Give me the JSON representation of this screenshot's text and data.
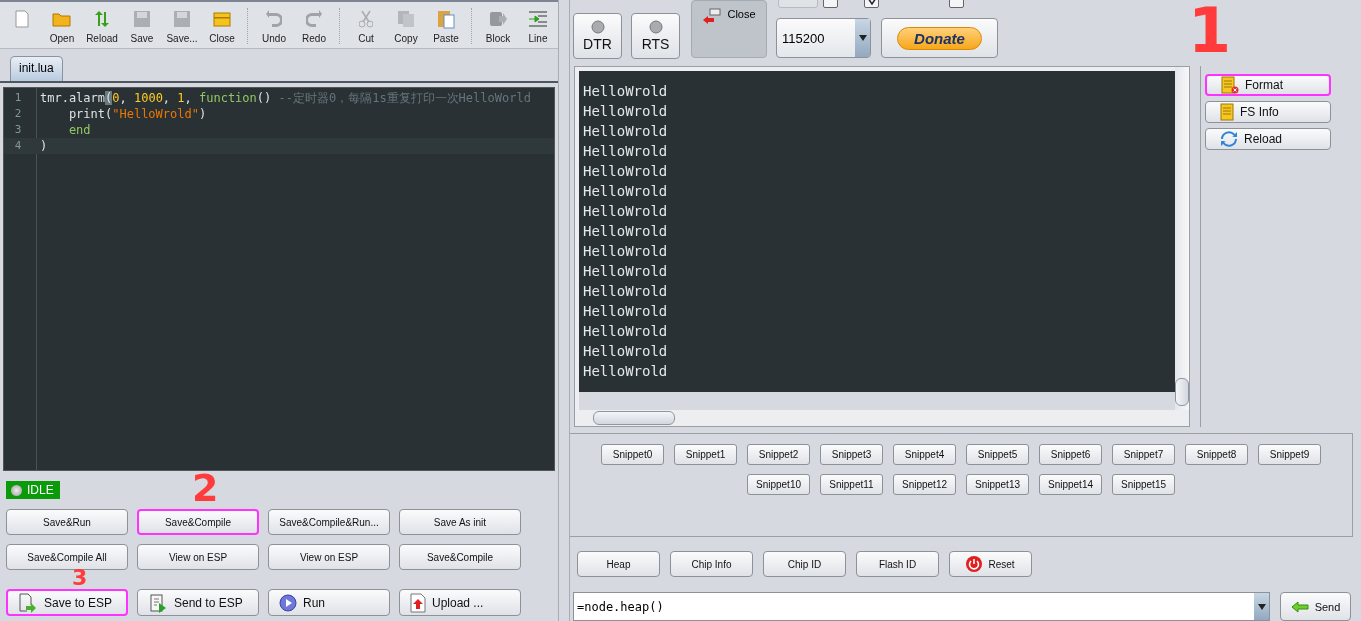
{
  "toolbar": {
    "groups": [
      [
        {
          "kind": "new",
          "disabled": false
        },
        {
          "label": "Open",
          "disabled": false
        },
        {
          "label": "Reload",
          "disabled": false
        },
        {
          "label": "Save",
          "disabled": true
        },
        {
          "label": "Save...",
          "disabled": true
        },
        {
          "label": "Close",
          "disabled": false
        }
      ],
      [
        {
          "label": "Undo",
          "disabled": true
        },
        {
          "label": "Redo",
          "disabled": true
        }
      ],
      [
        {
          "label": "Cut",
          "disabled": true
        },
        {
          "label": "Copy",
          "disabled": true
        },
        {
          "label": "Paste",
          "disabled": false
        }
      ],
      [
        {
          "label": "Block",
          "disabled": true
        },
        {
          "label": "Line",
          "disabled": false
        }
      ]
    ]
  },
  "tabs": [
    {
      "label": "init.lua",
      "selected": true
    }
  ],
  "editor": {
    "lines": [
      {
        "number": "1",
        "current": false,
        "tokens": [
          {
            "kind": "plain",
            "text": "tmr.alarm"
          },
          {
            "kind": "cursor",
            "text": "("
          },
          {
            "kind": "number",
            "text": "0"
          },
          {
            "kind": "plain",
            "text": ", "
          },
          {
            "kind": "number",
            "text": "1000"
          },
          {
            "kind": "plain",
            "text": ", "
          },
          {
            "kind": "number",
            "text": "1"
          },
          {
            "kind": "plain",
            "text": ", "
          },
          {
            "kind": "keyword",
            "text": "function"
          },
          {
            "kind": "plain",
            "text": "() "
          },
          {
            "kind": "comment",
            "text": "--定时器0，每隔1s重复打印一次HelloWorld"
          }
        ]
      },
      {
        "number": "2",
        "current": false,
        "tokens": [
          {
            "kind": "plain",
            "text": "    print("
          },
          {
            "kind": "string",
            "text": "\"HelloWrold\""
          },
          {
            "kind": "plain",
            "text": ")"
          }
        ]
      },
      {
        "number": "3",
        "current": false,
        "tokens": [
          {
            "kind": "keyword",
            "text": "    end"
          }
        ]
      },
      {
        "number": "4",
        "current": true,
        "tokens": [
          {
            "kind": "plain",
            "text": ")"
          }
        ]
      }
    ]
  },
  "status": {
    "label": "IDLE"
  },
  "actions": [
    {
      "label": "Save&Run",
      "highlighted": false
    },
    {
      "label": "Save&Compile",
      "highlighted": true
    },
    {
      "label": "Save&Compile&Run...",
      "highlighted": false
    },
    {
      "label": "Save As init",
      "highlighted": false
    },
    {
      "label": "Save&Compile All",
      "highlighted": false
    },
    {
      "label": "View on ESP",
      "highlighted": false
    },
    {
      "label": "View on ESP",
      "highlighted": false
    },
    {
      "label": "Save&Compile",
      "highlighted": false
    }
  ],
  "main_actions": [
    {
      "label": "Save to ESP",
      "highlighted": true
    },
    {
      "label": "Send to ESP",
      "highlighted": false
    },
    {
      "label": "Run",
      "highlighted": false
    },
    {
      "label": "Upload ...",
      "highlighted": false
    }
  ],
  "serial": {
    "dtr": {
      "label": "DTR"
    },
    "rts": {
      "label": "RTS"
    },
    "close": {
      "label": "Close"
    },
    "checkboxes": [
      {
        "checked": false
      },
      {
        "checked": true
      },
      {
        "checked": false
      }
    ],
    "baud": {
      "value": "115200"
    },
    "donate": {
      "label": "Donate"
    }
  },
  "terminal": {
    "lines": [
      "HelloWrold",
      "HelloWrold",
      "HelloWrold",
      "HelloWrold",
      "HelloWrold",
      "HelloWrold",
      "HelloWrold",
      "HelloWrold",
      "HelloWrold",
      "HelloWrold",
      "HelloWrold",
      "HelloWrold",
      "HelloWrold",
      "HelloWrold",
      "HelloWrold"
    ]
  },
  "file_buttons": [
    {
      "label": "Format",
      "highlighted": true
    },
    {
      "label": "FS Info",
      "highlighted": false
    },
    {
      "label": "Reload",
      "highlighted": false
    }
  ],
  "snippets": [
    [
      "Snippet0",
      "Snippet1",
      "Snippet2",
      "Snippet3",
      "Snippet4",
      "Snippet5",
      "Snippet6",
      "Snippet7",
      "Snippet8",
      "Snippet9"
    ],
    [
      "Snippet10",
      "Snippet11",
      "Snippet12",
      "Snippet13",
      "Snippet14",
      "Snippet15"
    ]
  ],
  "info_buttons": [
    {
      "label": "Heap"
    },
    {
      "label": "Chip Info"
    },
    {
      "label": "Chip ID"
    },
    {
      "label": "Flash ID"
    },
    {
      "label": "Reset"
    }
  ],
  "command": {
    "value": "=node.heap()",
    "send": "Send"
  },
  "annotations": [
    {
      "text": "1"
    },
    {
      "text": "2"
    },
    {
      "text": "3"
    }
  ]
}
